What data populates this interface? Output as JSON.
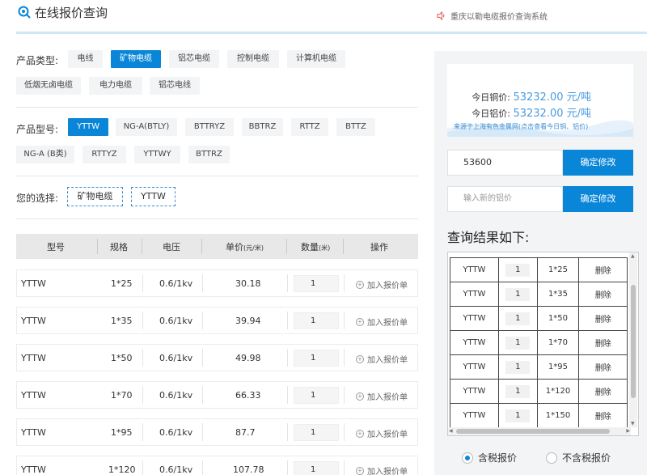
{
  "header": {
    "title": "在线报价查询",
    "notice": "重庆以勒电缆报价查询系统"
  },
  "filters": {
    "product_type_label": "产品类型:",
    "product_types": [
      "电线",
      "矿物电缆",
      "铝芯电缆",
      "控制电缆",
      "计算机电缆",
      "低烟无卤电缆",
      "电力电缆",
      "铝芯电线"
    ],
    "product_type_selected": "矿物电缆",
    "model_label": "产品型号:",
    "models": [
      "YTTW",
      "NG-A(BTLY)",
      "BTTRYZ",
      "BBTRZ",
      "RTTZ",
      "BTTZ",
      "NG-A (B类)",
      "RTTYZ",
      "YTTWY",
      "BTTRZ"
    ],
    "model_selected": "YTTW",
    "choice_label": "您的选择:",
    "choices": [
      "矿物电缆",
      "YTTW"
    ]
  },
  "table": {
    "headers": {
      "model": "型号",
      "spec": "规格",
      "voltage": "电压",
      "price": "单价",
      "price_unit": "(元/米)",
      "qty": "数量",
      "qty_unit": "(米)",
      "action": "操作"
    },
    "rows": [
      {
        "model": "YTTW",
        "spec": "1*25",
        "voltage": "0.6/1kv",
        "price": "30.18",
        "qty": "1",
        "action": "加入报价单"
      },
      {
        "model": "YTTW",
        "spec": "1*35",
        "voltage": "0.6/1kv",
        "price": "39.94",
        "qty": "1",
        "action": "加入报价单"
      },
      {
        "model": "YTTW",
        "spec": "1*50",
        "voltage": "0.6/1kv",
        "price": "49.98",
        "qty": "1",
        "action": "加入报价单"
      },
      {
        "model": "YTTW",
        "spec": "1*70",
        "voltage": "0.6/1kv",
        "price": "66.33",
        "qty": "1",
        "action": "加入报价单"
      },
      {
        "model": "YTTW",
        "spec": "1*95",
        "voltage": "0.6/1kv",
        "price": "87.7",
        "qty": "1",
        "action": "加入报价单"
      },
      {
        "model": "YTTW",
        "spec": "1*120",
        "voltage": "0.6/1kv",
        "price": "107.78",
        "qty": "1",
        "action": "加入报价单"
      }
    ]
  },
  "prices": {
    "copper_label": "今日铜价:",
    "copper_value": "53232.00 元/吨",
    "aluminum_label": "今日铝价:",
    "aluminum_value": "53232.00 元/吨",
    "source": "来源于上海有色金属网(点击查看今日铜、铝价)"
  },
  "copper_input": {
    "value": "53600",
    "button": "确定修改"
  },
  "aluminum_input": {
    "placeholder": "输入新的铝价",
    "button": "确定修改"
  },
  "results": {
    "title": "查询结果如下:",
    "rows": [
      {
        "model": "YTTW",
        "qty": "1",
        "spec": "1*25",
        "action": "删除"
      },
      {
        "model": "YTTW",
        "qty": "1",
        "spec": "1*35",
        "action": "删除"
      },
      {
        "model": "YTTW",
        "qty": "1",
        "spec": "1*50",
        "action": "删除"
      },
      {
        "model": "YTTW",
        "qty": "1",
        "spec": "1*70",
        "action": "删除"
      },
      {
        "model": "YTTW",
        "qty": "1",
        "spec": "1*95",
        "action": "删除"
      },
      {
        "model": "YTTW",
        "qty": "1",
        "spec": "1*120",
        "action": "删除"
      },
      {
        "model": "YTTW",
        "qty": "1",
        "spec": "1*150",
        "action": "删除"
      }
    ]
  },
  "tax": {
    "with_tax": "含税报价",
    "without_tax": "不含税报价",
    "selected": "含税报价"
  },
  "colors": {
    "accent": "#0a86d8",
    "price_blue": "#4a9be0"
  }
}
